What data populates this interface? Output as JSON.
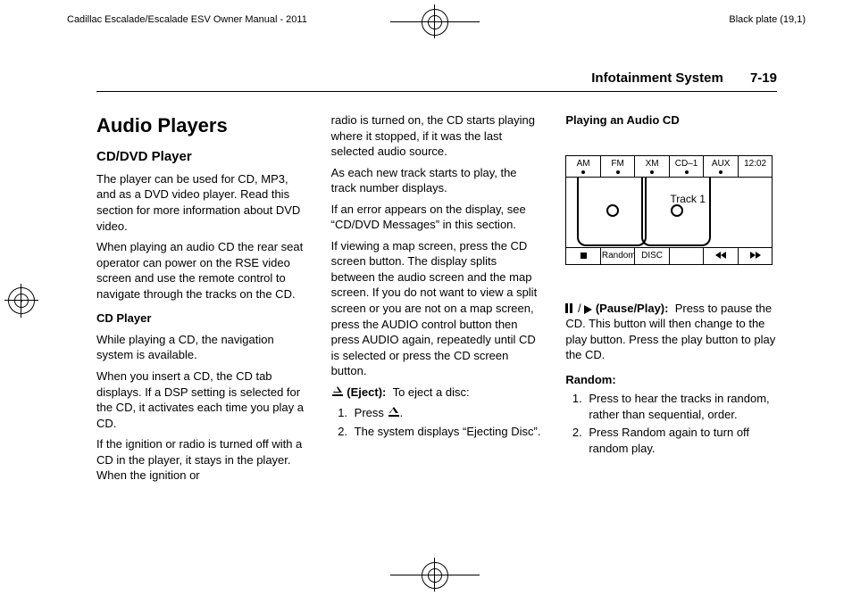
{
  "header": {
    "manual": "Cadillac Escalade/Escalade ESV Owner Manual - 2011",
    "plate": "Black plate (19,1)"
  },
  "running_head": {
    "title": "Infotainment System",
    "page": "7-19"
  },
  "col1": {
    "h1": "Audio Players",
    "h2": "CD/DVD Player",
    "p1": "The player can be used for CD, MP3, and as a DVD video player. Read this section for more information about DVD video.",
    "p2": "When playing an audio CD the rear seat operator can power on the RSE video screen and use the remote control to navigate through the tracks on the CD.",
    "sub1": "CD Player",
    "p3": "While playing a CD, the navigation system is available.",
    "p4": "When you insert a CD, the CD tab displays. If a DSP setting is selected for the CD, it activates each time you play a CD.",
    "p5": "If the ignition or radio is turned off with a CD in the player, it stays in the player. When the ignition or"
  },
  "col2": {
    "p1": "radio is turned on, the CD starts playing where it stopped, if it was the last selected audio source.",
    "p2": "As each new track starts to play, the track number displays.",
    "p3": "If an error appears on the display, see “CD/DVD Messages” in this section.",
    "p4": "If viewing a map screen, press the CD screen button. The display splits between the audio screen and the map screen. If you do not want to view a split screen or you are not on a map screen, press the AUDIO control button then press AUDIO again, repeatedly until CD is selected or press the CD screen button.",
    "eject_label": "(Eject):",
    "eject_desc": "To eject a disc:",
    "eject_steps": [
      {
        "prefix": "Press ",
        "suffix": "."
      },
      {
        "text": "The system displays “Ejecting Disc”."
      }
    ]
  },
  "col3": {
    "sub1": "Playing an Audio CD",
    "display": {
      "top": [
        "AM",
        "FM",
        "XM",
        "CD–1",
        "AUX",
        "12:02"
      ],
      "track": "Track 1",
      "bottom": {
        "random": "Random",
        "disc": "DISC"
      }
    },
    "pauseplay_label": "(Pause/Play):",
    "pauseplay_desc": "Press to pause the CD. This button will then change to the play button. Press the play button to play the CD.",
    "random_heading": "Random:",
    "random_items": [
      "Press to hear the tracks in random, rather than sequential, order.",
      "Press Random again to turn off random play."
    ]
  }
}
